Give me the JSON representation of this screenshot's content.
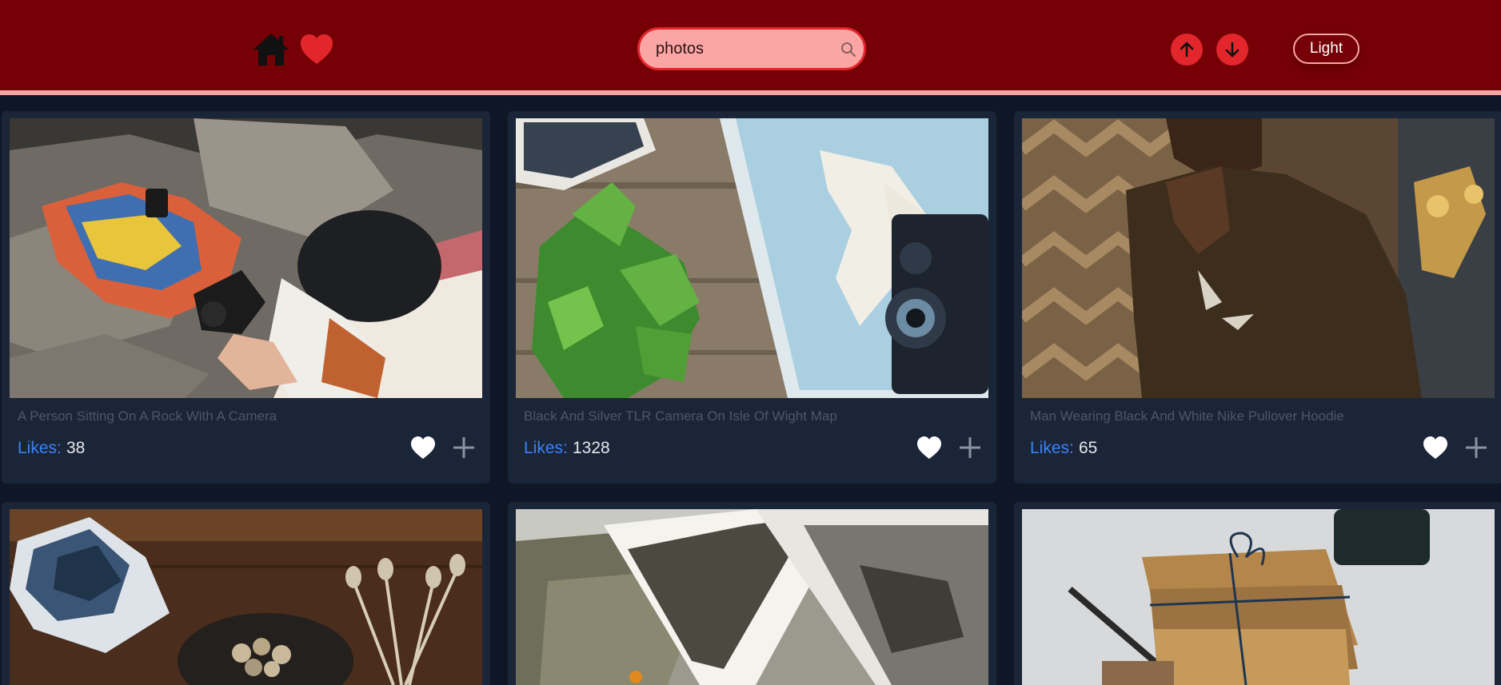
{
  "header": {
    "search": {
      "value": "photos"
    },
    "theme_button_label": "Light",
    "colors": {
      "bar": "#750006",
      "accent": "#e3262b",
      "search_bg": "#fca5a5"
    },
    "icons": [
      "home-icon",
      "heart-icon",
      "search-icon",
      "arrow-up-icon",
      "arrow-down-icon"
    ]
  },
  "cards": [
    {
      "title": "A Person Sitting On A Rock With A Camera",
      "likes_label": "Likes:",
      "likes": "38"
    },
    {
      "title": "Black And Silver TLR Camera On Isle Of Wight Map",
      "likes_label": "Likes:",
      "likes": "1328"
    },
    {
      "title": "Man Wearing Black And White Nike Pullover Hoodie",
      "likes_label": "Likes:",
      "likes": "65"
    },
    {
      "title": "",
      "likes_label": "",
      "likes": ""
    },
    {
      "title": "",
      "likes_label": "",
      "likes": ""
    },
    {
      "title": "",
      "likes_label": "",
      "likes": ""
    }
  ]
}
